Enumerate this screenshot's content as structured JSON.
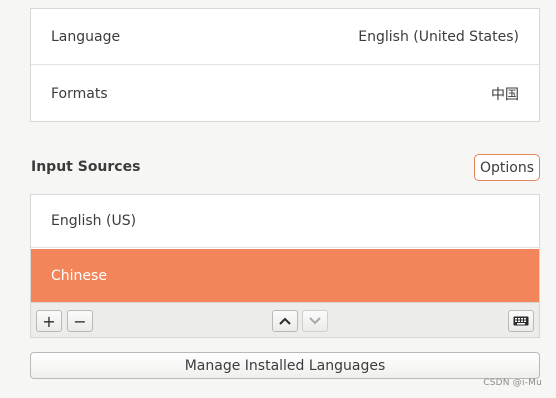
{
  "settings": {
    "language_label": "Language",
    "language_value": "English (United States)",
    "formats_label": "Formats",
    "formats_value": "中国"
  },
  "input_sources": {
    "title": "Input Sources",
    "options_label": "Options",
    "items": [
      {
        "label": "English (US)",
        "selected": false
      },
      {
        "label": "Chinese",
        "selected": true
      }
    ],
    "toolbar": {
      "add_symbol": "+",
      "remove_symbol": "−",
      "up_icon": "chevron-up-icon",
      "down_icon": "chevron-down-icon",
      "keyboard_icon": "keyboard-icon"
    }
  },
  "manage_label": "Manage Installed Languages",
  "watermark": "CSDN @i-Mu",
  "colors": {
    "selection": "#f2855a",
    "options_border": "#e4845e"
  }
}
